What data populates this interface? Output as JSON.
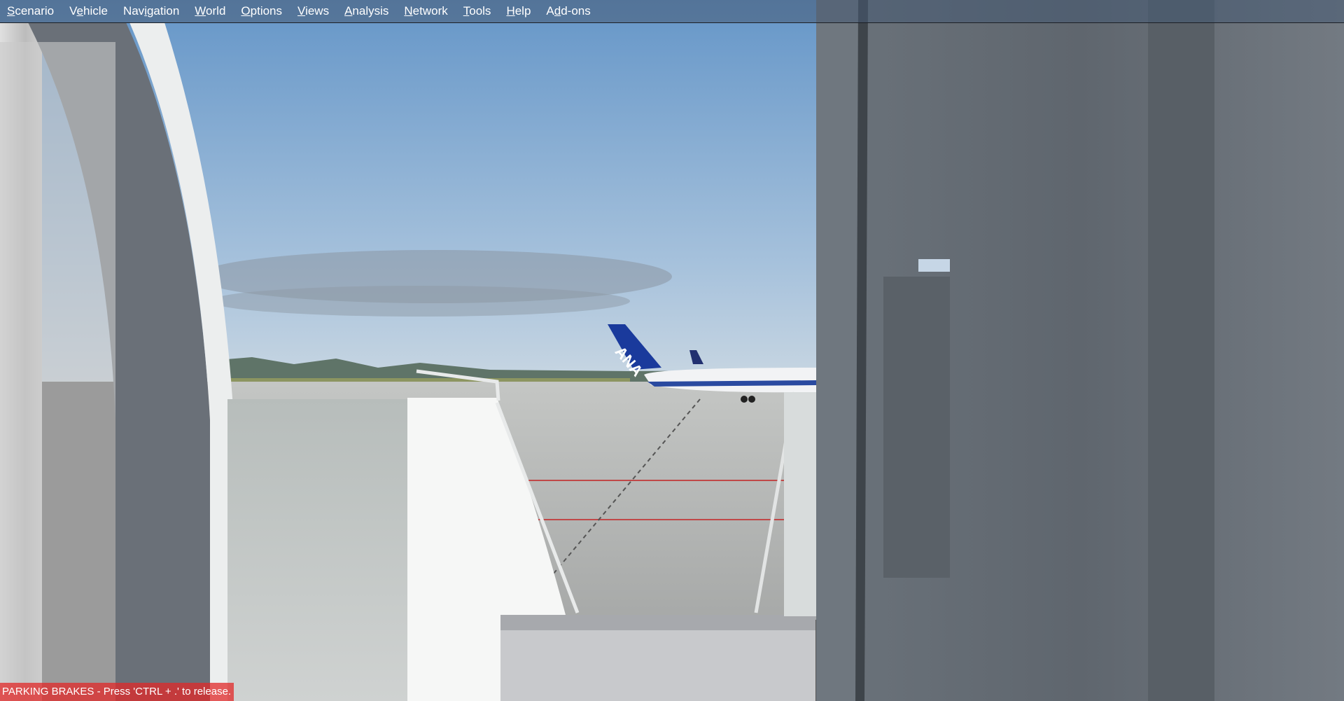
{
  "menubar": {
    "items": [
      {
        "label": "Scenario",
        "accel": "S"
      },
      {
        "label": "Vehicle",
        "accel": "e"
      },
      {
        "label": "Navigation",
        "accel": "i"
      },
      {
        "label": "World",
        "accel": "W"
      },
      {
        "label": "Options",
        "accel": "O"
      },
      {
        "label": "Views",
        "accel": "V"
      },
      {
        "label": "Analysis",
        "accel": "A"
      },
      {
        "label": "Network",
        "accel": "N"
      },
      {
        "label": "Tools",
        "accel": "T"
      },
      {
        "label": "Help",
        "accel": "H"
      },
      {
        "label": "Add-ons",
        "accel": "d"
      }
    ]
  },
  "status": {
    "notice": "PARKING BRAKES - Press 'CTRL + .' to release.",
    "notice_color": "#e02828"
  },
  "scene": {
    "airline_tail_text": "ANA",
    "colors": {
      "sky_top": "#6a9ccd",
      "sky_bottom": "#b8cde0",
      "tarmac": "#b4b6b4",
      "fuselage": "#6c747c"
    }
  }
}
